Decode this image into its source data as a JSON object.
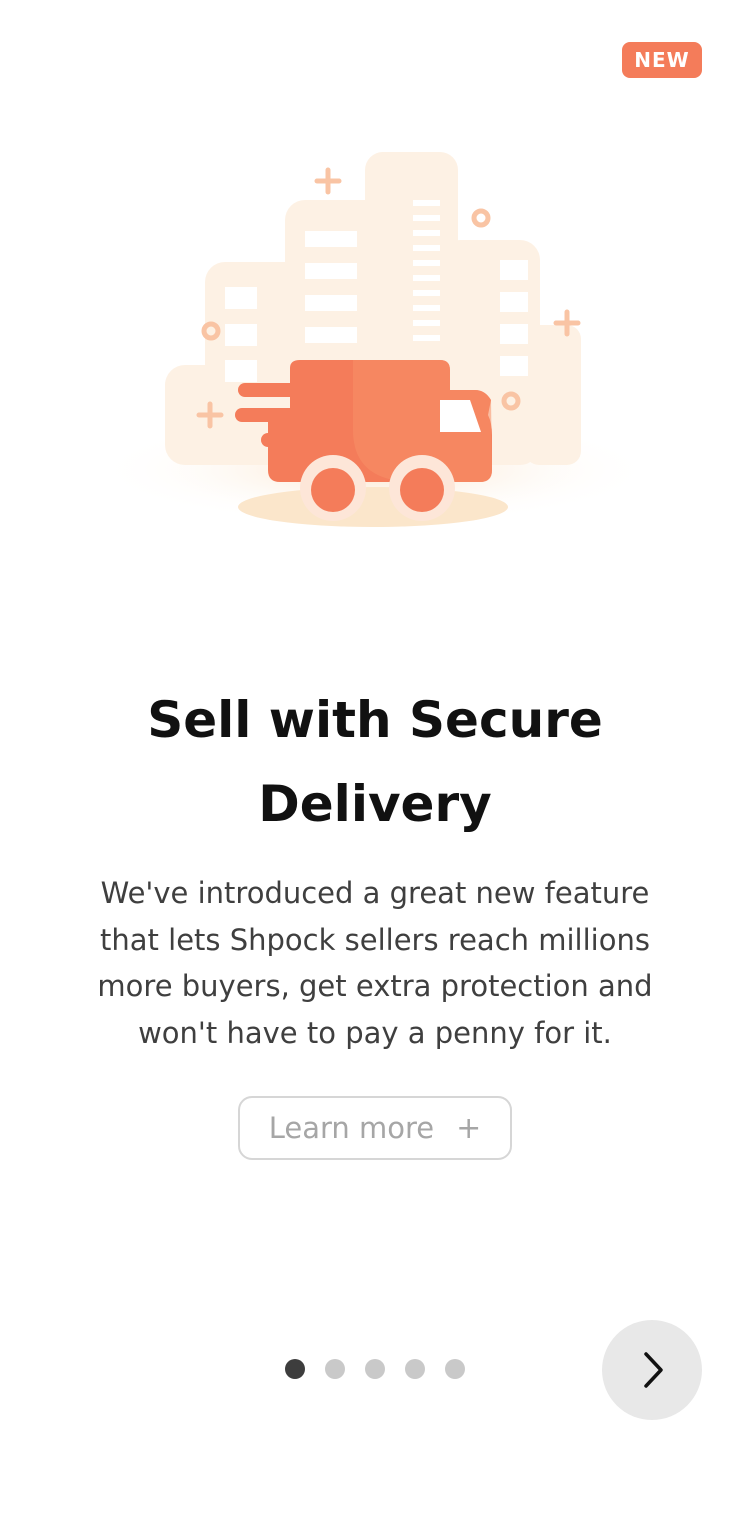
{
  "badge": {
    "label": "NEW"
  },
  "illustration": {
    "icon": "delivery-truck-city-icon"
  },
  "onboarding": {
    "title": "Sell with Secure Delivery",
    "description": "We've introduced a great new feature that lets Shpock sellers reach millions more buyers, get extra protection and won't have to pay a penny for it.",
    "learn_more_label": "Learn more",
    "learn_more_icon": "plus-icon"
  },
  "pagination": {
    "total_pages": 5,
    "current_page": 1
  },
  "next_button": {
    "icon": "chevron-right-icon"
  },
  "colors": {
    "accent": "#f47c5a",
    "truck": "#f47c5a",
    "building": "#fdf1e4",
    "active_dot": "#3d3d3d",
    "inactive_dot": "#c9c9c9"
  }
}
